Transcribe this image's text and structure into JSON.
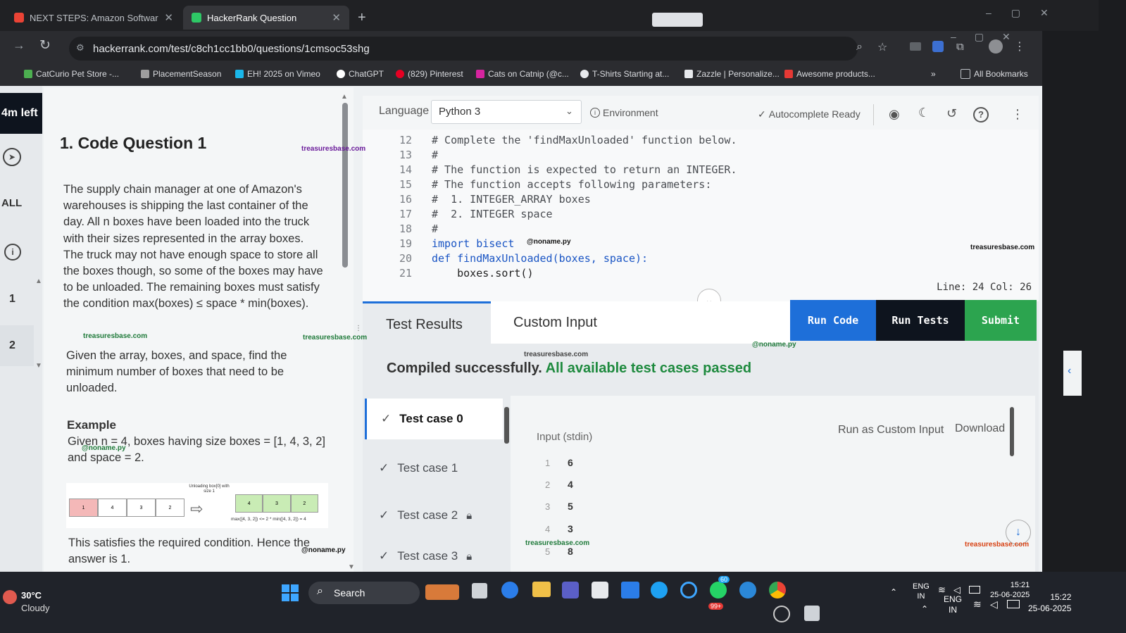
{
  "browser": {
    "tabs": [
      {
        "title": "NEXT STEPS: Amazon Softwar",
        "active": false
      },
      {
        "title": "HackerRank Question",
        "active": true
      }
    ],
    "url": "hackerrank.com/test/c8ch1cc1bb0/questions/1cmsoc53shg",
    "bookmarks": [
      "CatCurio Pet Store -...",
      "PlacementSeason",
      "EH! 2025 on Vimeo",
      "ChatGPT",
      "(829) Pinterest",
      "Cats on Catnip (@c...",
      "T-Shirts Starting at...",
      "Zazzle | Personalize...",
      "Awesome products..."
    ],
    "all_bookmarks": "All Bookmarks"
  },
  "sidebar": {
    "timer": "4m left",
    "all_label": "ALL",
    "q1": "1",
    "q2": "2"
  },
  "problem": {
    "title": "1. Code Question 1",
    "para1": "The supply chain manager at one of Amazon's warehouses is shipping the last container of the day. All n boxes have been loaded into the truck with their sizes represented in the array boxes. The truck may not have enough space to store all the boxes though, so some of the boxes may have to be unloaded. The remaining boxes must satisfy the condition max(boxes) ≤ space * min(boxes).",
    "para2": "Given the array, boxes, and space, find the minimum number of boxes that need to be unloaded.",
    "example_heading": "Example",
    "example_text": "Given n = 4, boxes having size boxes = [1, 4, 3, 2] and space = 2.",
    "diagram": {
      "left_boxes": [
        "1",
        "4",
        "3",
        "2"
      ],
      "arrow_label": "Unloading box[0] with size 1",
      "right_boxes": [
        "4",
        "3",
        "2"
      ],
      "caption": "max([4, 3, 2]) <= 2 * min([4, 3, 2]) = 4"
    },
    "conclusion": "This satisfies the required condition. Hence the answer is 1."
  },
  "editor": {
    "language_label": "Language",
    "language_value": "Python 3",
    "environment": "Environment",
    "autocomplete": "Autocomplete Ready",
    "lines": [
      {
        "n": "12",
        "text": "# Complete the 'findMaxUnloaded' function below."
      },
      {
        "n": "13",
        "text": "#"
      },
      {
        "n": "14",
        "text": "# The function is expected to return an INTEGER."
      },
      {
        "n": "15",
        "text": "# The function accepts following parameters:"
      },
      {
        "n": "16",
        "text": "#  1. INTEGER_ARRAY boxes"
      },
      {
        "n": "17",
        "text": "#  2. INTEGER space"
      },
      {
        "n": "18",
        "text": "#"
      },
      {
        "n": "19",
        "text": "import bisect"
      },
      {
        "n": "20",
        "text": "def findMaxUnloaded(boxes, space):"
      },
      {
        "n": "21",
        "text": "    boxes.sort()"
      }
    ],
    "cursor_pos": "Line: 24 Col: 26"
  },
  "results": {
    "tab_results": "Test Results",
    "tab_custom": "Custom Input",
    "run_code": "Run Code",
    "run_tests": "Run Tests",
    "submit": "Submit",
    "status_compiled": "Compiled successfully.",
    "status_passed": "All available test cases passed",
    "test_cases": [
      "Test case 0",
      "Test case 1",
      "Test case 2",
      "Test case 3"
    ],
    "input_label": "Input (stdin)",
    "run_custom": "Run as Custom Input",
    "download": "Download",
    "input_lines": [
      {
        "n": "1",
        "v": "6"
      },
      {
        "n": "2",
        "v": "4"
      },
      {
        "n": "3",
        "v": "5"
      },
      {
        "n": "4",
        "v": "3"
      },
      {
        "n": "5",
        "v": "8"
      }
    ]
  },
  "watermarks": [
    "treasuresbase.com",
    "@noname.py"
  ],
  "taskbar": {
    "weather_temp": "30°C",
    "weather_desc": "Cloudy",
    "search": "Search",
    "lang1": "ENG",
    "lang2": "IN",
    "time_inner": "15:21",
    "date_inner": "25-06-2025",
    "time_outer": "15:22",
    "date_outer": "25-06-2025",
    "badge1": "60",
    "badge2": "99+"
  }
}
